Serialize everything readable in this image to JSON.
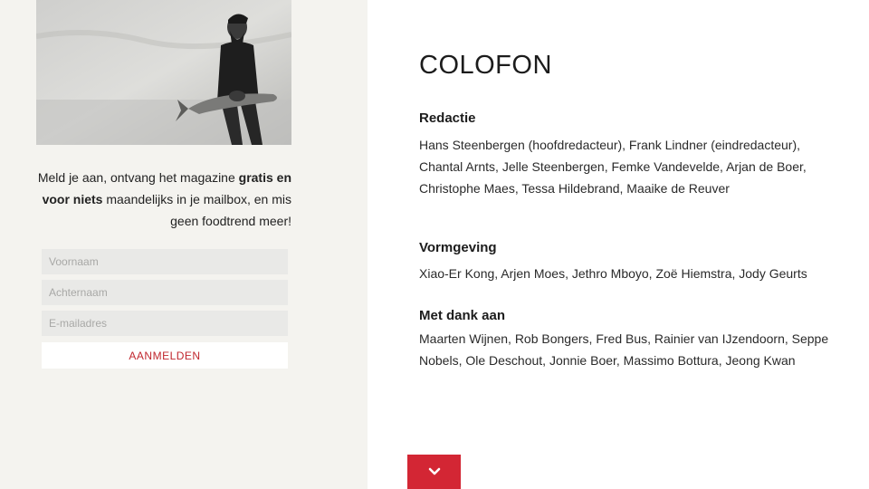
{
  "signup": {
    "text_pre": "Meld je aan, ontvang het magazine ",
    "text_bold": "gratis en voor niets",
    "text_post": " maandelijks in je mailbox, en mis geen foodtrend meer!",
    "firstname_placeholder": "Voornaam",
    "lastname_placeholder": "Achternaam",
    "email_placeholder": "E-mailadres",
    "button_label": "AANMELDEN"
  },
  "colofon": {
    "title": "COLOFON",
    "sections": [
      {
        "heading": "Redactie",
        "text": "Hans Steenbergen (hoofdredacteur), Frank Lindner (eindredacteur), Chantal Arnts, Jelle Steenbergen, Femke Vandevelde, Arjan de Boer, Christophe Maes, Tessa Hildebrand, Maaike de Reuver"
      },
      {
        "heading": "Vormgeving",
        "text": "Xiao-Er Kong, Arjen Moes, Jethro Mboyo, Zoë Hiemstra, Jody Geurts"
      },
      {
        "heading": "Met dank aan",
        "text": "Maarten Wijnen, Rob Bongers, Fred Bus, Rainier van IJzendoorn, Seppe Nobels, Ole Deschout, Jonnie Boer, Massimo Bottura, Jeong Kwan"
      }
    ]
  },
  "colors": {
    "accent": "#d32634",
    "panel": "#f4f3ef"
  },
  "icons": {
    "scroll_down": "chevron-down-icon"
  }
}
